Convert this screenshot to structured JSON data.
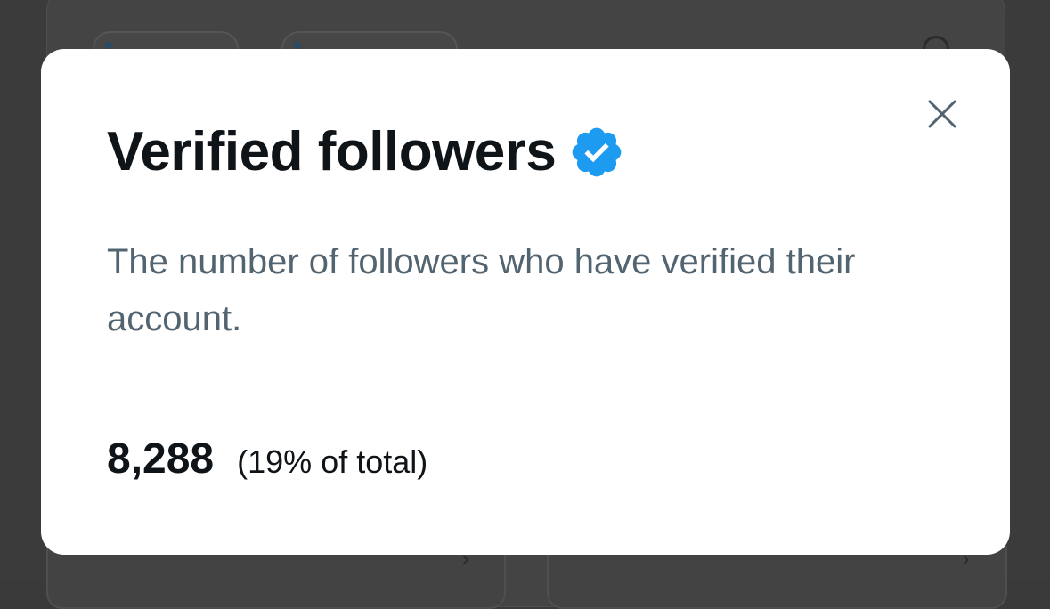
{
  "modal": {
    "title": "Verified followers",
    "badge_icon": "verified-badge-icon",
    "badge_color": "#1d9bf0",
    "description": "The number of followers who have verified their account.",
    "stat_value": "8,288",
    "stat_share": "(19% of total)",
    "close_icon": "close-icon"
  },
  "colors": {
    "title": "#0f1419",
    "description": "#536471",
    "modal_background": "#ffffff",
    "backdrop": "#3b3b3b"
  }
}
